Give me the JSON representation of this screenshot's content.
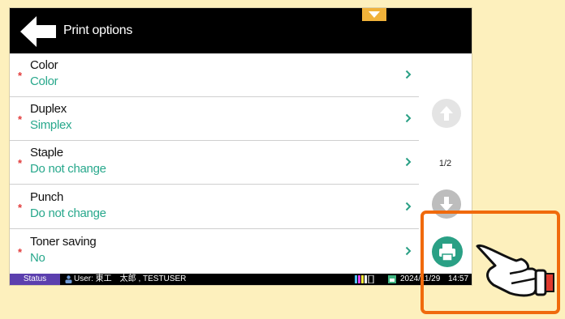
{
  "header": {
    "title": "Print options",
    "back_icon": "back-arrow-icon",
    "menu_icon": "chevron-down-icon",
    "menu_color": "#f0b23a"
  },
  "options": [
    {
      "name": "Color",
      "value": "Color",
      "required": "*"
    },
    {
      "name": "Duplex",
      "value": "Simplex",
      "required": "*"
    },
    {
      "name": "Staple",
      "value": "Do not change",
      "required": "*"
    },
    {
      "name": "Punch",
      "value": "Do not change",
      "required": "*"
    },
    {
      "name": "Toner saving",
      "value": "No",
      "required": "*"
    }
  ],
  "pager": {
    "indicator": "1/2",
    "up_icon": "arrow-up-icon",
    "down_icon": "arrow-down-icon"
  },
  "actions": {
    "print_icon": "printer-icon",
    "print_color": "#2aa085"
  },
  "status_bar": {
    "status_label": "Status",
    "user_text": "User: 東工　太郎 , TESTUSER",
    "date": "2024/11/29",
    "time": "14:57"
  },
  "colors": {
    "value_text": "#28a88c",
    "required_mark": "#e23b3b",
    "highlight_border": "#f06a0c",
    "background": "#fdf0bd"
  }
}
